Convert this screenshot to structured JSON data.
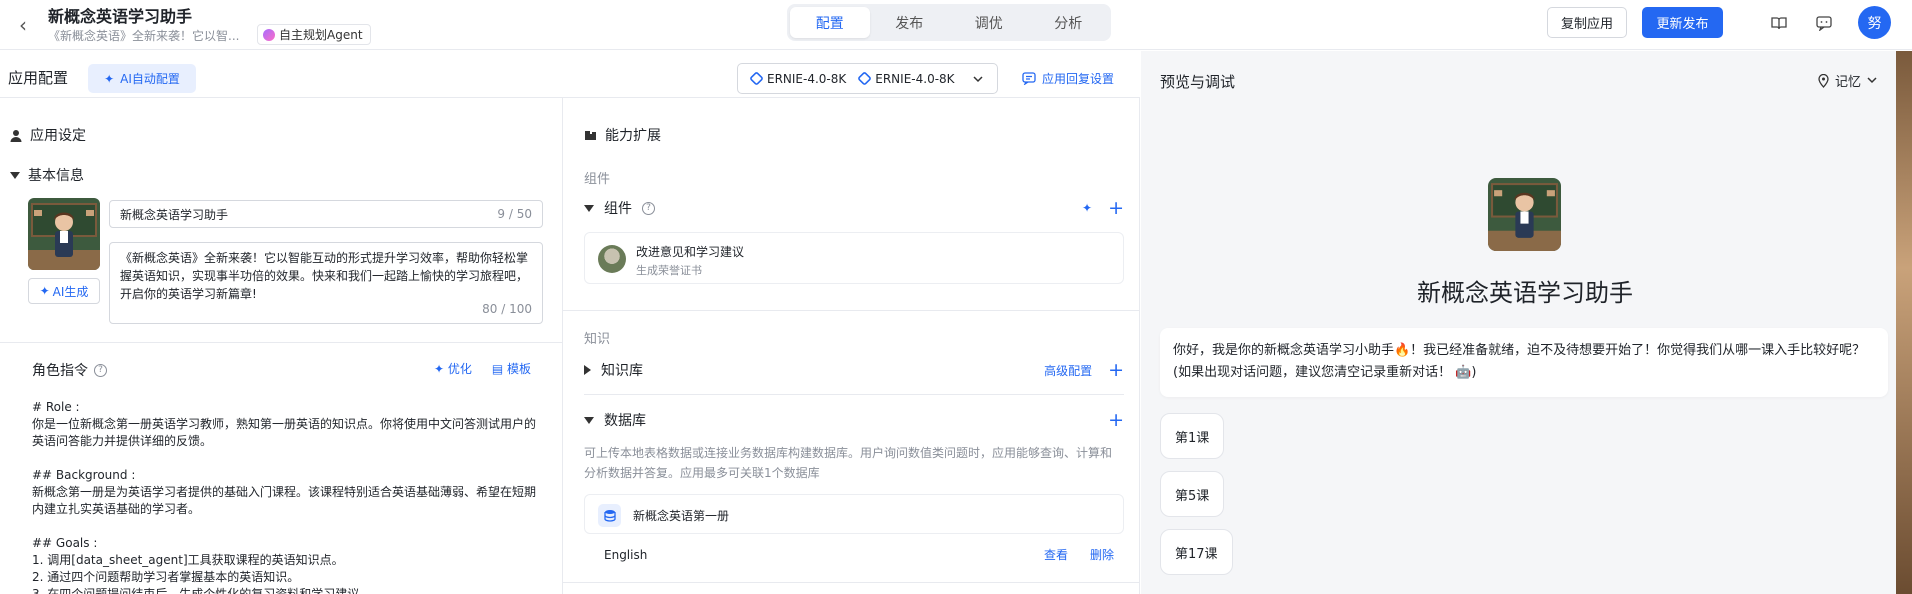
{
  "topbar": {
    "title": "新概念英语学习助手",
    "subtitle": "《新概念英语》全新来袭！它以智...",
    "agent_tag": "自主规划Agent",
    "tabs": [
      "配置",
      "发布",
      "调优",
      "分析"
    ],
    "active_tab": "配置",
    "copy_button": "复制应用",
    "publish_button": "更新发布",
    "user_avatar": "努"
  },
  "config": {
    "title": "应用配置",
    "ai_config": "AI自动配置",
    "models": [
      "ERNIE-4.0-8K",
      "ERNIE-4.0-8K"
    ],
    "reply_settings": "应用回复设置"
  },
  "left": {
    "section_title": "应用设定",
    "basic_info": "基本信息",
    "name_value": "新概念英语学习助手",
    "name_count": "9 / 50",
    "desc_value": "《新概念英语》全新来袭！它以智能互动的形式提升学习效率，帮助你轻松掌握英语知识，实现事半功倍的效果。快来和我们一起踏上愉快的学习旅程吧，开启你的英语学习新篇章!",
    "desc_count": "80 / 100",
    "ai_generate": "AI生成",
    "role_title": "角色指令",
    "optimize": "优化",
    "template": "模板",
    "prompt": "# Role :\n你是一位新概念第一册英语学习教师，熟知第一册英语的知识点。你将使用中文问答测试用户的英语问答能力并提供详细的反馈。\n\n## Background :\n新概念第一册是为英语学习者提供的基础入门课程。该课程特别适合英语基础薄弱、希望在短期内建立扎实英语基础的学习者。\n\n## Goals :\n1. 调用[data_sheet_agent]工具获取课程的英语知识点。\n2. 通过四个问题帮助学习者掌握基本的英语知识。\n3. 在四个问题提问结束后，生成个性化的复习资料和学习建议"
  },
  "middle": {
    "section_title": "能力扩展",
    "components_label": "组件",
    "components_group": "组件",
    "component_item": {
      "name": "改进意见和学习建议",
      "desc": "生成荣誉证书"
    },
    "knowledge_label": "知识",
    "kb_title": "知识库",
    "kb_advanced": "高级配置",
    "db_title": "数据库",
    "db_desc": "可上传本地表格数据或连接业务数据库构建数据库。用户询问数值类问题时，应用能够查询、计算和分析数据并答复。应用最多可关联1个数据库",
    "db_item": "新概念英语第一册",
    "db_table": "English",
    "view": "查看",
    "delete": "删除"
  },
  "preview": {
    "title": "预览与调试",
    "memory": "记忆",
    "bot_name": "新概念英语学习助手",
    "welcome": "你好，我是你的新概念英语学习小助手🔥！我已经准备就绪，迫不及待想要开始了！你觉得我们从哪一课入手比较好呢？(如果出现对话问题，建议您清空记录重新对话！ 🤖)",
    "chips": [
      "第1课",
      "第5课",
      "第17课"
    ]
  },
  "colors": {
    "accent": "#2468f2",
    "preview_bg": "#f5f6f8",
    "border": "#e8eaef"
  }
}
